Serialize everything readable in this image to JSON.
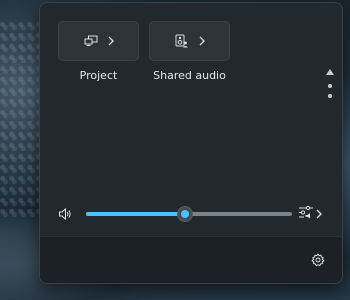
{
  "quick_settings": {
    "tiles": [
      {
        "label": "Project",
        "icon": "project-icon"
      },
      {
        "label": "Shared audio",
        "icon": "speaker-people-icon"
      }
    ],
    "volume": {
      "level_percent": 48,
      "icon": "speaker-icon"
    },
    "footer": {
      "settings_icon": "gear-icon"
    }
  },
  "colors": {
    "accent": "#4cc2ff",
    "panel": "#21282e"
  }
}
